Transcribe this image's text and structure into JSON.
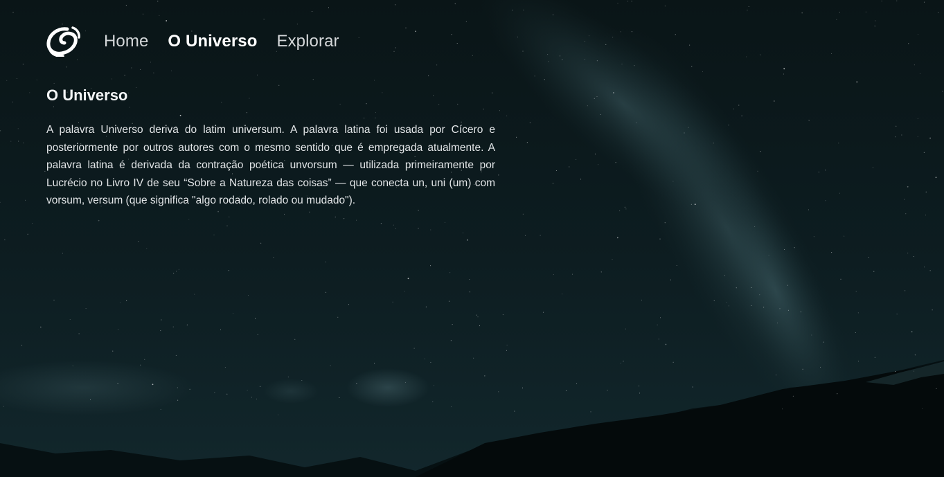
{
  "brand": {
    "logo_icon": "swirl-logo-icon"
  },
  "nav": {
    "items": [
      {
        "label": "Home",
        "active": false
      },
      {
        "label": "O Universo",
        "active": true
      },
      {
        "label": "Explorar",
        "active": false
      }
    ]
  },
  "article": {
    "title": "O Universo",
    "body": "A palavra Universo deriva do latim universum. A palavra latina foi usada por Cícero e posteriormente por outros autores com o mesmo sentido que é empregada atualmente. A palavra latina é derivada da contração poética unvorsum — utilizada primeiramente por Lucrécio no Livro IV de seu “Sobre a Natureza das coisas” — que conecta un, uni (um) com vorsum, versum (que significa \"algo rodado, rolado ou mudado\")."
  },
  "background": {
    "description_icon": "night-sky-milky-way-mountains",
    "sky_top": "#0b1719",
    "sky_bottom": "#0e2025",
    "milky_way": "#2a4a50",
    "mountain": "#05090a"
  }
}
